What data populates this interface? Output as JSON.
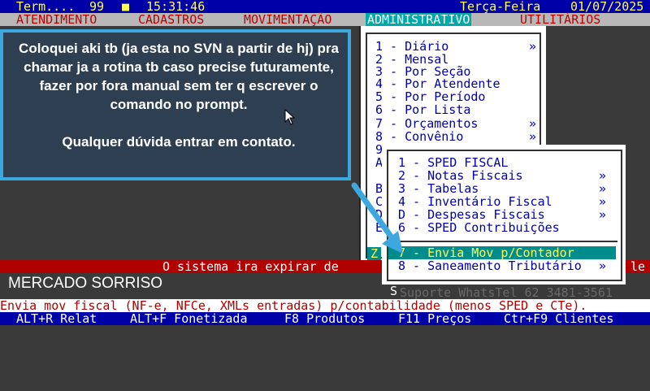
{
  "topbar": {
    "term_label": "Term....",
    "term_value": "99",
    "square_icon": "■",
    "time": "15:31:46",
    "weekday": "Terça-Feira",
    "date": "01/07/2025"
  },
  "menubar": {
    "items": [
      "ATENDIMENTO",
      "CADASTROS",
      "MOVIMENTAÇÃO",
      "ADMINISTRATIVO",
      "UTILITÁRIOS"
    ],
    "active": "ADMINISTRATIVO"
  },
  "dropdown": {
    "items": [
      {
        "label": "1 - Diário",
        "arrow": "»"
      },
      {
        "label": "2 - Mensal",
        "arrow": ""
      },
      {
        "label": "3 - Por Seção",
        "arrow": ""
      },
      {
        "label": "4 - Por Atendente",
        "arrow": ""
      },
      {
        "label": "5 - Por Período",
        "arrow": ""
      },
      {
        "label": "6 - Por Lista",
        "arrow": ""
      },
      {
        "label": "7 - Orçamentos",
        "arrow": "»"
      },
      {
        "label": "8 - Convênio",
        "arrow": "»"
      },
      {
        "label": "9",
        "arrow": ""
      },
      {
        "label": "A",
        "arrow": ""
      },
      {
        "label": "B",
        "arrow": ""
      },
      {
        "label": "C",
        "arrow": ""
      },
      {
        "label": "D",
        "arrow": ""
      },
      {
        "label": "E",
        "arrow": ""
      },
      {
        "label": "Z",
        "arrow": ""
      }
    ]
  },
  "submenu": {
    "items": [
      {
        "label": "1 - SPED FISCAL",
        "arrow": ""
      },
      {
        "label": "2 - Notas Fiscais",
        "arrow": "»"
      },
      {
        "label": "3 - Tabelas",
        "arrow": "»"
      },
      {
        "label": "4 - Inventário Fiscal",
        "arrow": "»"
      },
      {
        "label": "D - Despesas Fiscais",
        "arrow": "»"
      },
      {
        "label": "6 - SPED Contribuições",
        "arrow": ""
      },
      {
        "label": "7 - Envia Mov p/Contador",
        "arrow": "",
        "selected": true
      },
      {
        "label": "8 - Saneamento Tributário",
        "arrow": "»"
      }
    ],
    "below_letter": "S"
  },
  "expire": {
    "text": "O sistema ira expirar de",
    "right_fragment": "le"
  },
  "support_faint": "Suporte WhatsTel 62 3481-3561",
  "company": "MERCADO SORRISO",
  "helpline": "Envia mov fiscal (NF-e, NFCe, XMLs entradas) p/contabilidade (menos SPED e CTe).",
  "shortcuts": [
    "ALT+R Relat",
    "ALT+F Fonetizada",
    "F8 Produtos",
    "F11 Preços",
    "Ctr+F9 Clientes"
  ],
  "callout": {
    "paragraph1": "Coloquei aki tb (ja esta no SVN a partir de hj) pra chamar ja a rotina tb caso precise futuramente, fazer por fora manual sem ter q escrever o comando no prompt.",
    "paragraph2": "Qualquer dúvida entrar em contato."
  },
  "colors": {
    "accent_blue": "#3ca8df",
    "menu_active": "#00a8a8",
    "selection": "#008c8c",
    "dos_blue": "#0000a8",
    "dos_red": "#b00000"
  }
}
